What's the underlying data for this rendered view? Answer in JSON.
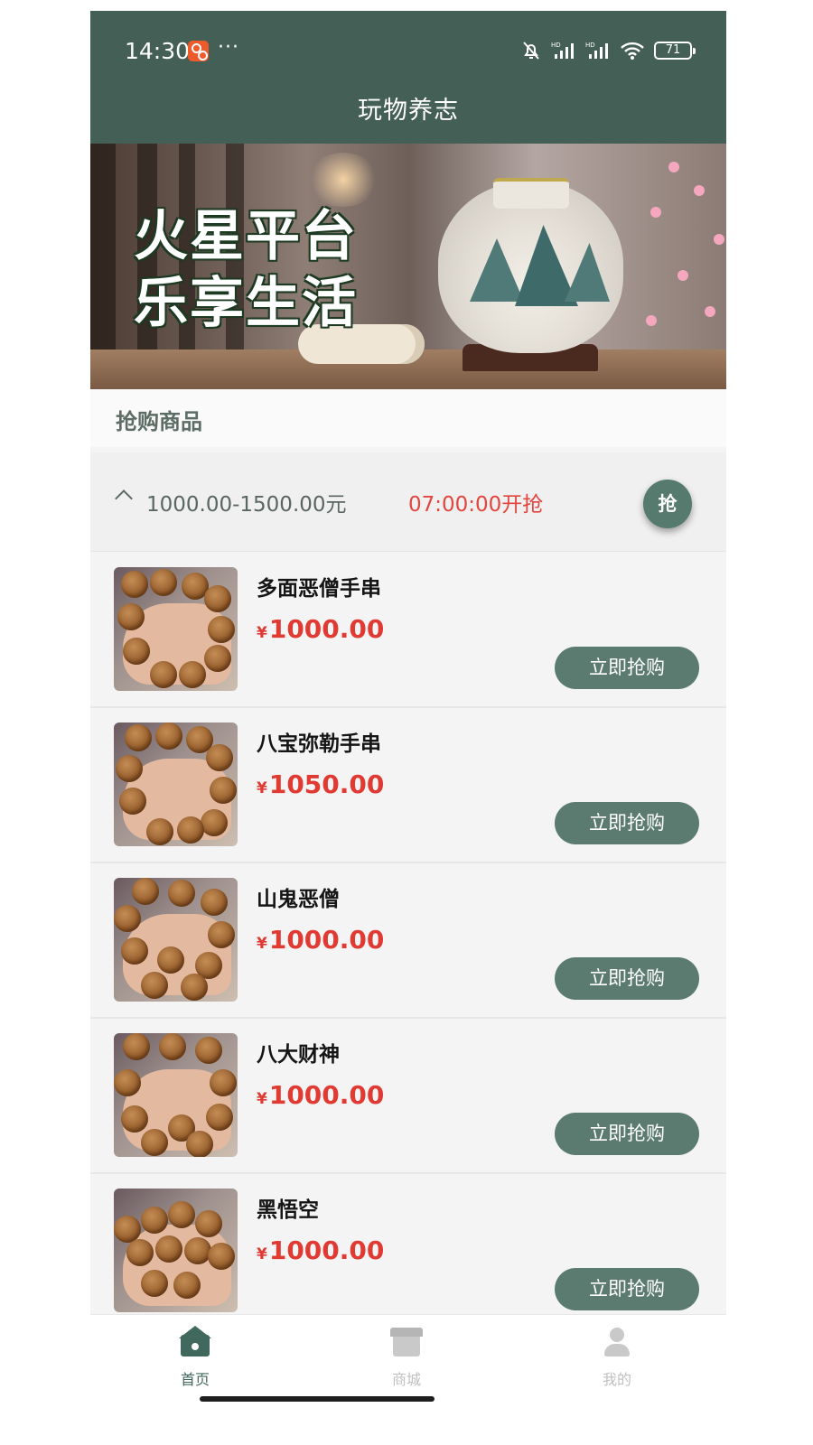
{
  "status_bar": {
    "time": "14:30",
    "dots": "···",
    "battery": "71",
    "icons": [
      "app-badge-icon",
      "bell-off-icon",
      "signal-hd-icon",
      "signal-hd-icon",
      "wifi-icon",
      "battery-icon"
    ]
  },
  "header": {
    "title": "玩物养志"
  },
  "banner": {
    "line1": "火星平台",
    "line2": "乐享生活"
  },
  "section": {
    "title": "抢购商品"
  },
  "group": {
    "price_range": "1000.00-1500.00元",
    "start_time": "07:00:00开抢",
    "grab_label": "抢"
  },
  "products": [
    {
      "name": "多面恶僧手串",
      "currency": "¥",
      "price": "1000.00",
      "button": "立即抢购"
    },
    {
      "name": "八宝弥勒手串",
      "currency": "¥",
      "price": "1050.00",
      "button": "立即抢购"
    },
    {
      "name": "山鬼恶僧",
      "currency": "¥",
      "price": "1000.00",
      "button": "立即抢购"
    },
    {
      "name": "八大财神",
      "currency": "¥",
      "price": "1000.00",
      "button": "立即抢购"
    },
    {
      "name": "黑悟空",
      "currency": "¥",
      "price": "1000.00",
      "button": "立即抢购"
    }
  ],
  "tabbar": {
    "tabs": [
      {
        "label": "首页",
        "icon": "home-icon",
        "active": true
      },
      {
        "label": "商城",
        "icon": "store-icon",
        "active": false
      },
      {
        "label": "我的",
        "icon": "user-icon",
        "active": false
      }
    ]
  },
  "colors": {
    "header_bg": "#445f55",
    "accent": "#5b7a70",
    "price_red": "#e03a33",
    "active_tab": "#41685c",
    "inactive_tab": "#c9c9c9"
  }
}
